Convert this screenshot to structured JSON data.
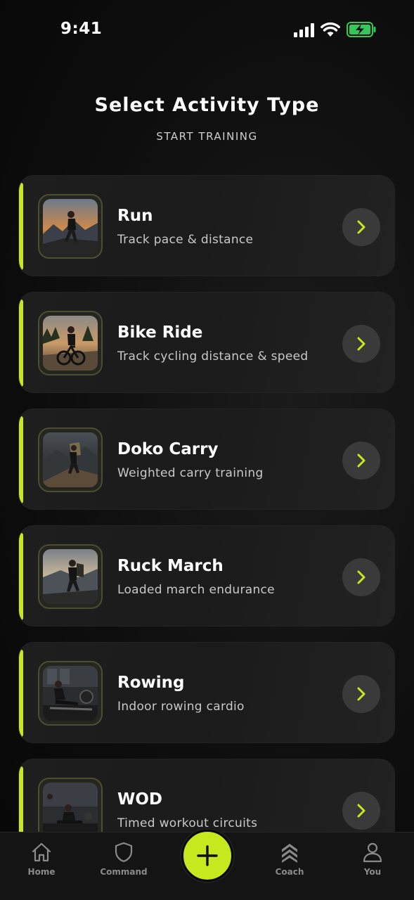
{
  "status_bar": {
    "time": "9:41",
    "battery_color": "#34c759"
  },
  "header": {
    "title": "Select Activity Type",
    "subtitle": "START TRAINING"
  },
  "colors": {
    "accent": "#c5e81e",
    "card_bg": "#1d1d1d",
    "background": "#0a0a0a"
  },
  "activities": [
    {
      "title": "Run",
      "description": "Track pace & distance",
      "icon": "runner-photo"
    },
    {
      "title": "Bike Ride",
      "description": "Track cycling distance & speed",
      "icon": "cyclist-photo"
    },
    {
      "title": "Doko Carry",
      "description": "Weighted carry training",
      "icon": "hiker-photo"
    },
    {
      "title": "Ruck March",
      "description": "Loaded march endurance",
      "icon": "ruck-photo"
    },
    {
      "title": "Rowing",
      "description": "Indoor rowing cardio",
      "icon": "rower-photo"
    },
    {
      "title": "WOD",
      "description": "Timed workout circuits",
      "icon": "workout-photo"
    }
  ],
  "bottom_nav": {
    "items": [
      {
        "label": "Home",
        "icon": "home-icon"
      },
      {
        "label": "Command",
        "icon": "shield-icon"
      },
      {
        "label": "Coach",
        "icon": "chevrons-up-icon"
      },
      {
        "label": "You",
        "icon": "user-icon"
      }
    ],
    "fab_icon": "plus-icon"
  }
}
